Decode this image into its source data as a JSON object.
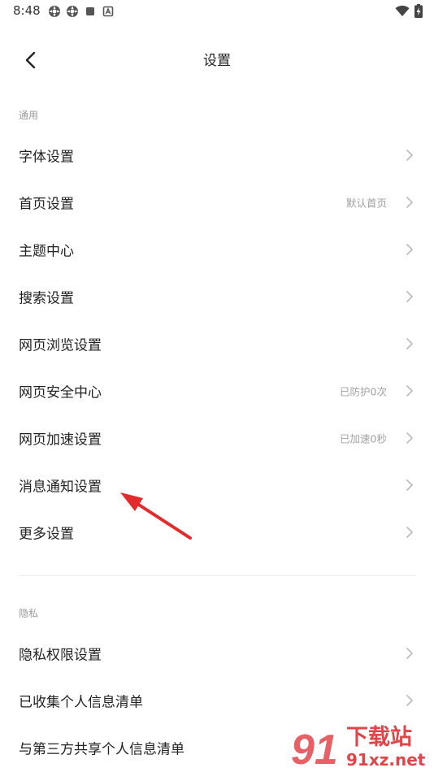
{
  "status_bar": {
    "time": "8:48",
    "left_icons": [
      "settings-flower-icon",
      "settings-flower-icon",
      "square-icon",
      "a-badge-icon"
    ],
    "right_icons": [
      "wifi-icon",
      "battery-charging-icon"
    ]
  },
  "header": {
    "title": "设置"
  },
  "sections": [
    {
      "title": "通用",
      "items": [
        {
          "label": "字体设置",
          "value": ""
        },
        {
          "label": "首页设置",
          "value": "默认首页"
        },
        {
          "label": "主题中心",
          "value": ""
        },
        {
          "label": "搜索设置",
          "value": ""
        },
        {
          "label": "网页浏览设置",
          "value": ""
        },
        {
          "label": "网页安全中心",
          "value": "已防护0次"
        },
        {
          "label": "网页加速设置",
          "value": "已加速0秒"
        },
        {
          "label": "消息通知设置",
          "value": ""
        },
        {
          "label": "更多设置",
          "value": ""
        }
      ]
    },
    {
      "title": "隐私",
      "items": [
        {
          "label": "隐私权限设置",
          "value": ""
        },
        {
          "label": "已收集个人信息清单",
          "value": ""
        },
        {
          "label": "与第三方共享个人信息清单",
          "value": ""
        }
      ]
    }
  ],
  "watermark": {
    "brand": "下载站",
    "site": "91xz.net",
    "logo_text": "91"
  },
  "colors": {
    "arrow": "#e32b2b",
    "watermark": "#e0454a",
    "secondary_text": "#a0a0a0",
    "divider": "#ececec"
  }
}
